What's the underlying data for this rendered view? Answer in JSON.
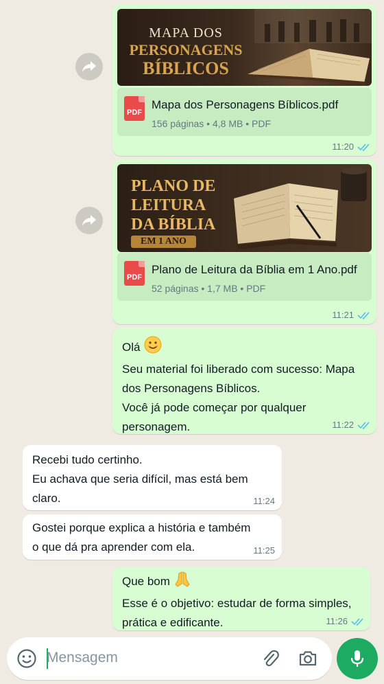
{
  "messages": [
    {
      "type": "document",
      "thumbnail": {
        "line1": "MAPA DOS",
        "line2": "PERSONAGENS",
        "line3": "BÍBLICOS"
      },
      "file_name": "Mapa dos Personagens Bíblicos.pdf",
      "meta": "156 páginas • 4,8 MB • PDF",
      "icon_label": "PDF",
      "time": "11:20"
    },
    {
      "type": "document",
      "thumbnail": {
        "line1": "PLANO DE",
        "line2": "LEITURA",
        "line3": "DA BÍBLIA",
        "badge": "EM 1 ANO"
      },
      "file_name": "Plano de Leitura da Bíblia em 1 Ano.pdf",
      "meta": "52 páginas • 1,7 MB • PDF",
      "icon_label": "PDF",
      "time": "11:21"
    },
    {
      "type": "text_out",
      "lines": [
        "Olá",
        "Seu material foi liberado com sucesso: Mapa",
        "dos Personagens Bíblicos.",
        "Você já pode começar por qualquer",
        "personagem."
      ],
      "time": "11:22"
    },
    {
      "type": "text_in",
      "lines": [
        "Recebi tudo certinho.",
        "Eu achava que seria difícil, mas está bem",
        "claro."
      ],
      "time": "11:24"
    },
    {
      "type": "text_in",
      "lines": [
        "Gostei porque explica a história e também",
        "o que dá pra aprender com ela."
      ],
      "time": "11:25"
    },
    {
      "type": "text_out",
      "lines": [
        "Que bom",
        "Esse é o objetivo: estudar de forma simples,",
        "prática e edificante."
      ],
      "time": "11:26"
    }
  ],
  "input": {
    "placeholder": "Mensagem"
  },
  "colors": {
    "chat_bg": "#efeae2",
    "bubble_out": "#d9fdd3",
    "bubble_in": "#ffffff",
    "read_ticks": "#53bdeb",
    "accent": "#1daa61",
    "pdf_red": "#e94b4b"
  },
  "icons": [
    "forward-icon",
    "pdf-icon",
    "double-check-icon",
    "emoji-icon",
    "attach-icon",
    "camera-icon",
    "mic-icon"
  ]
}
